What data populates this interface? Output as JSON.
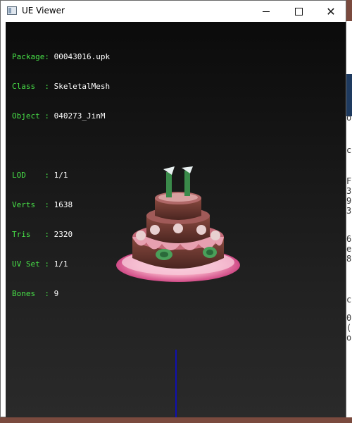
{
  "window": {
    "title": "UE Viewer",
    "minimize_glyph": "",
    "maximize_glyph": "",
    "close_glyph": "✕"
  },
  "info": {
    "package_label": "Package:",
    "package_value": "00043016.upk",
    "class_label": "Class  :",
    "class_value": "SkeletalMesh",
    "object_label": "Object :",
    "object_value": "040273_JinM",
    "lod_label": "LOD    :",
    "lod_value": "1/1",
    "verts_label": "Verts  :",
    "verts_value": "1638",
    "tris_label": "Tris   :",
    "tris_value": "2320",
    "uvset_label": "UV Set :",
    "uvset_value": "1/1",
    "bones_label": "Bones  :",
    "bones_value": "9"
  },
  "side_window_chars": [
    "o",
    "c",
    "F",
    "3",
    "9",
    "3",
    "6",
    "e",
    "8",
    "c",
    "0",
    "(",
    "o"
  ],
  "colors": {
    "label_green": "#48e048",
    "value_white": "#ffffff",
    "axis_blue": "#1010b0"
  }
}
